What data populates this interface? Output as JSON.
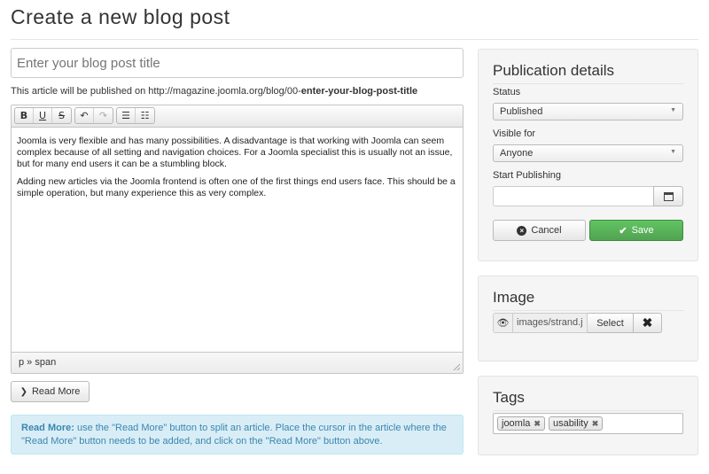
{
  "page": {
    "title": "Create a new blog post"
  },
  "post": {
    "title_placeholder": "Enter your blog post title",
    "url_prefix": "This article will be published on http://magazine.joomla.org/blog/00-",
    "url_slug": "enter-your-blog-post-title"
  },
  "editor": {
    "toolbar": {
      "bold": "B",
      "underline": "U",
      "strike": "S",
      "undo": "↶",
      "redo": "↷",
      "bullets": "☰",
      "numbers": "☷"
    },
    "paragraphs": [
      "Joomla is very flexible and has many possibilities. A disadvantage is that working with Joomla can seem complex because of all setting and navigation choices. For a Joomla specialist this is usually not an issue, but for many end users it can be a stumbling block.",
      "Adding new articles via the Joomla frontend is often one of the first things end users face. This should be a simple operation, but many experience this as very complex."
    ],
    "path": "p » span"
  },
  "read_more": {
    "button_label": "Read More",
    "hint_title": "Read More:",
    "hint_text": " use the \"Read More\" button to split an article. Place the cursor in the article where the \"Read More\" button needs to be added, and click on the \"Read More\" button above."
  },
  "publication": {
    "title": "Publication details",
    "status_label": "Status",
    "status_value": "Published",
    "visible_label": "Visible for",
    "visible_value": "Anyone",
    "start_label": "Start Publishing",
    "start_value": "",
    "cancel_label": "Cancel",
    "save_label": "Save",
    "save_color": "#5bb75b"
  },
  "image": {
    "title": "Image",
    "path": "images/strand.j",
    "select_label": "Select",
    "clear_symbol": "✖"
  },
  "tags": {
    "title": "Tags",
    "items": [
      "joomla",
      "usability"
    ]
  }
}
